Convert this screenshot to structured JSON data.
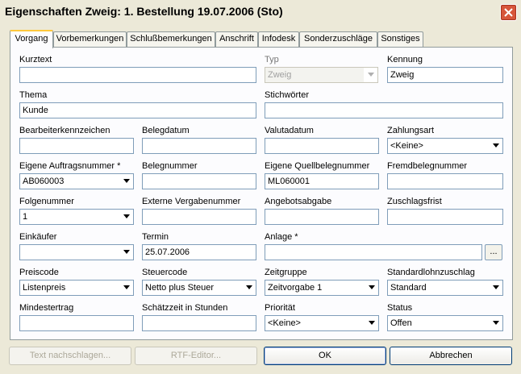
{
  "window": {
    "title": "Eigenschaften Zweig: 1. Bestellung 19.07.2006 (Sto)"
  },
  "tabs": [
    {
      "label": "Vorgang"
    },
    {
      "label": "Vorbemerkungen"
    },
    {
      "label": "Schlußbemerkungen"
    },
    {
      "label": "Anschrift"
    },
    {
      "label": "Infodesk"
    },
    {
      "label": "Sonderzuschläge"
    },
    {
      "label": "Sonstiges"
    }
  ],
  "form": {
    "kurztext": {
      "label": "Kurztext",
      "value": ""
    },
    "typ": {
      "label": "Typ",
      "value": "Zweig"
    },
    "kennung": {
      "label": "Kennung",
      "value": "Zweig"
    },
    "thema": {
      "label": "Thema",
      "value": "Kunde"
    },
    "stichwoerter": {
      "label": "Stichwörter",
      "value": ""
    },
    "bearbeiterkennzeichen": {
      "label": "Bearbeiterkennzeichen",
      "value": ""
    },
    "belegdatum": {
      "label": "Belegdatum",
      "value": ""
    },
    "valutadatum": {
      "label": "Valutadatum",
      "value": ""
    },
    "zahlungsart": {
      "label": "Zahlungsart",
      "value": "<Keine>"
    },
    "eigene_auftragsnummer": {
      "label": "Eigene Auftragsnummer *",
      "value": "AB060003"
    },
    "belegnummer": {
      "label": "Belegnummer",
      "value": ""
    },
    "eigene_quellbelegnummer": {
      "label": "Eigene Quellbelegnummer",
      "value": "ML060001"
    },
    "fremdbelegnummer": {
      "label": "Fremdbelegnummer",
      "value": ""
    },
    "folgenummer": {
      "label": "Folgenummer",
      "value": "1"
    },
    "externe_vergabenummer": {
      "label": "Externe Vergabenummer",
      "value": ""
    },
    "angebotsabgabe": {
      "label": "Angebotsabgabe",
      "value": ""
    },
    "zuschlagsfrist": {
      "label": "Zuschlagsfrist",
      "value": ""
    },
    "einkaeufer": {
      "label": "Einkäufer",
      "value": ""
    },
    "termin": {
      "label": "Termin",
      "value": "25.07.2006"
    },
    "anlage": {
      "label": "Anlage *",
      "value": "",
      "browse": "..."
    },
    "preiscode": {
      "label": "Preiscode",
      "value": "Listenpreis"
    },
    "steuercode": {
      "label": "Steuercode",
      "value": "Netto plus Steuer"
    },
    "zeitgruppe": {
      "label": "Zeitgruppe",
      "value": "Zeitvorgabe 1"
    },
    "standardlohnzuschlag": {
      "label": "Standardlohnzuschlag",
      "value": "Standard"
    },
    "mindestertrag": {
      "label": "Mindestertrag",
      "value": ""
    },
    "schaetzzeit": {
      "label": "Schätzzeit in Stunden",
      "value": ""
    },
    "prioritaet": {
      "label": "Priorität",
      "value": "<Keine>"
    },
    "status": {
      "label": "Status",
      "value": "Offen"
    }
  },
  "buttons": {
    "text_nachschlagen": "Text nachschlagen...",
    "rtf_editor": "RTF-Editor...",
    "ok": "OK",
    "abbrechen": "Abbrechen"
  }
}
